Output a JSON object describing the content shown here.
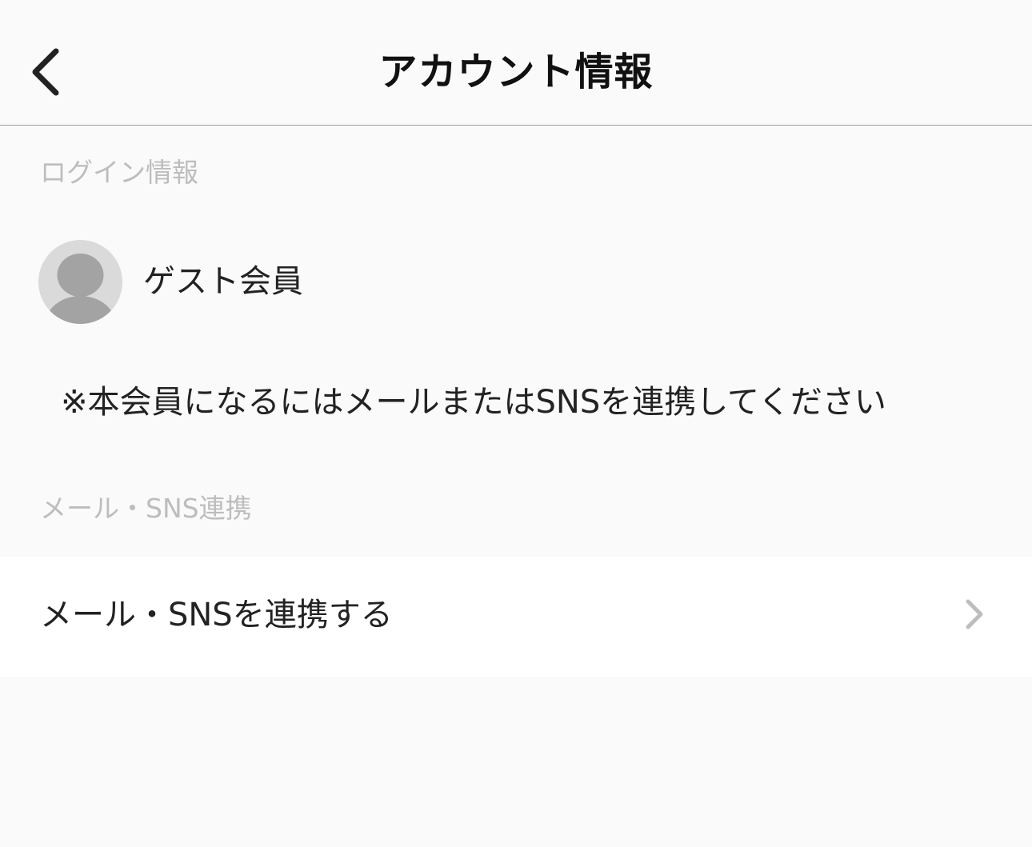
{
  "header": {
    "title": "アカウント情報",
    "back_icon": "chevron-left-icon"
  },
  "login_section": {
    "header": "ログイン情報",
    "user": {
      "avatar_icon": "person-avatar-icon",
      "name": "ゲスト会員"
    },
    "notice": "※本会員になるにはメールまたはSNSを連携してください"
  },
  "sns_section": {
    "header": "メール・SNS連携",
    "link_label": "メール・SNSを連携する",
    "link_icon": "chevron-right-icon"
  },
  "colors": {
    "background": "#fafafa",
    "row_background": "#ffffff",
    "section_header_text": "#bdbdbd",
    "divider": "#9e9e9e",
    "avatar_background": "#dadada",
    "avatar_figure": "#a3a3a3",
    "chevron": "#bdbdbd"
  }
}
